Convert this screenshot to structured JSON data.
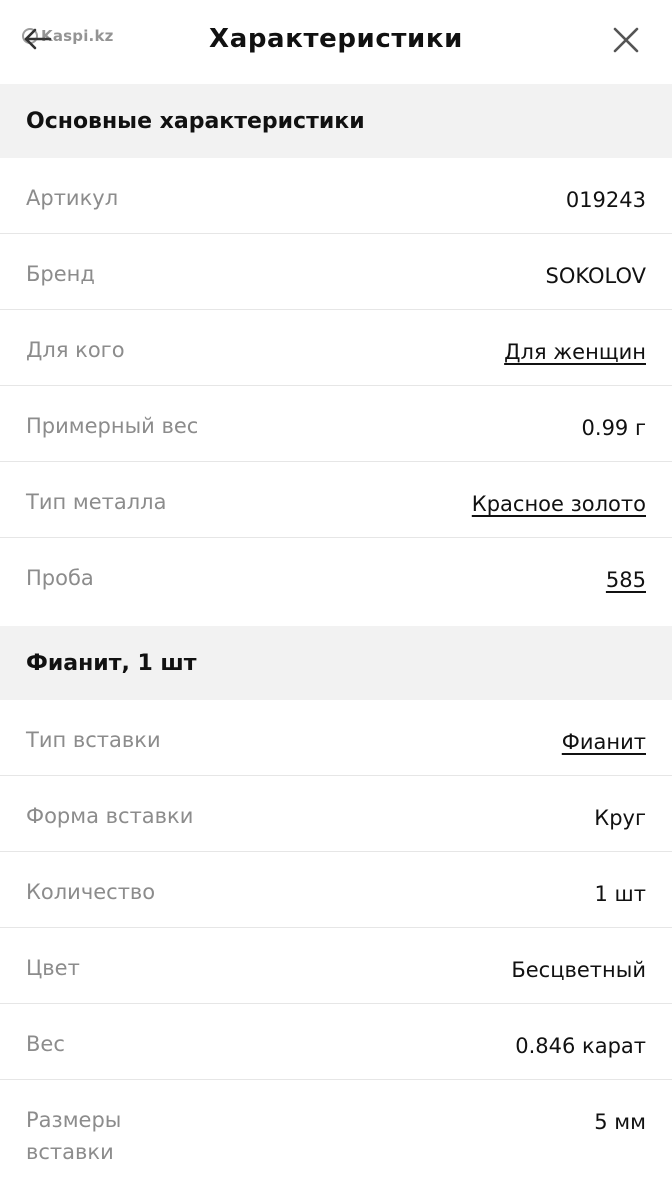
{
  "header": {
    "title": "Характеристики",
    "watermark": "Kaspi.kz"
  },
  "sections": [
    {
      "title": "Основные характеристики",
      "rows": [
        {
          "label": "Артикул",
          "value": "019243",
          "link": false
        },
        {
          "label": "Бренд",
          "value": "SOKOLOV",
          "link": false
        },
        {
          "label": "Для кого",
          "value": "Для женщин",
          "link": true
        },
        {
          "label": "Примерный вес",
          "value": "0.99 г",
          "link": false
        },
        {
          "label": "Тип металла",
          "value": "Красное золото",
          "link": true
        },
        {
          "label": "Проба",
          "value": "585",
          "link": true
        }
      ]
    },
    {
      "title": "Фианит, 1 шт",
      "rows": [
        {
          "label": "Тип вставки",
          "value": "Фианит",
          "link": true
        },
        {
          "label": "Форма вставки",
          "value": "Круг",
          "link": false
        },
        {
          "label": "Количество",
          "value": "1 шт",
          "link": false
        },
        {
          "label": "Цвет",
          "value": "Бесцветный",
          "link": false
        },
        {
          "label": "Вес",
          "value": "0.846 карат",
          "link": false
        },
        {
          "label": "Размеры вставки",
          "value": "5 мм",
          "link": false
        }
      ]
    }
  ],
  "icons": {
    "back": "arrow-left-icon",
    "close": "close-icon"
  }
}
